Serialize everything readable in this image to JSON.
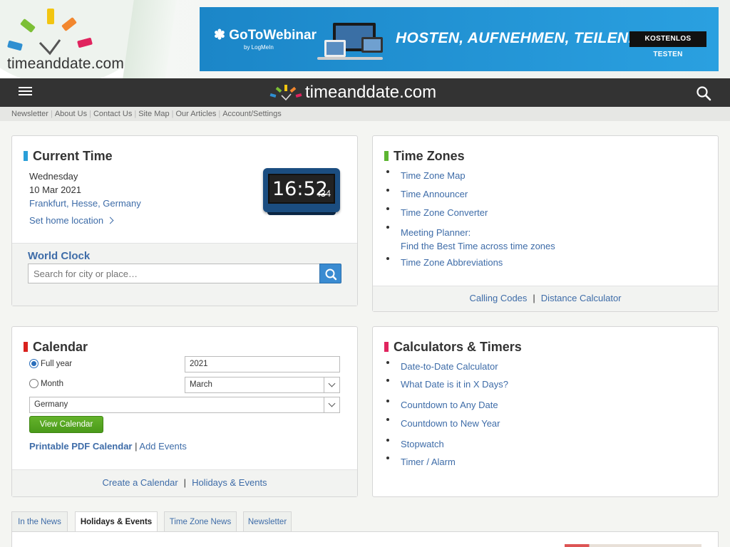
{
  "header": {
    "logo_text": "timeanddate.com",
    "ad": {
      "brand": "GoToWebinar",
      "brand_sub": "by LogMeIn",
      "headline": "HOSTEN, AUFNEHMEN, TEILEN.",
      "cta": "KOSTENLOS TESTEN"
    }
  },
  "navbar": {
    "brand": "timeanddate.com",
    "menu_icon": "hamburger-menu-icon",
    "search_icon": "search-icon"
  },
  "subnav": {
    "links": [
      "Newsletter",
      "About Us",
      "Contact Us",
      "Site Map",
      "Our Articles",
      "Account/Settings"
    ]
  },
  "current_time": {
    "title": "Current Time",
    "accent": "#2a9fd8",
    "day": "Wednesday",
    "date": "10 Mar 2021",
    "location": "Frankfurt, Hesse, Germany",
    "set_home": "Set home location",
    "clock": {
      "time": "16:52",
      "seconds": "34"
    },
    "world_clock": {
      "title": "World Clock",
      "placeholder": "Search for city or place…"
    }
  },
  "time_zones": {
    "title": "Time Zones",
    "accent": "#5cb531",
    "links": [
      "Time Zone Map",
      "Time Announcer",
      "Time Zone Converter",
      "Meeting Planner:",
      "Time Zone Abbreviations"
    ],
    "meeting_sub": "Find the Best Time across time zones",
    "footer": [
      "Calling Codes",
      "Distance Calculator"
    ]
  },
  "calendar": {
    "title": "Calendar",
    "accent": "#d9211d",
    "full_year_label": "Full year",
    "month_label": "Month",
    "year_value": "2021",
    "month_value": "March",
    "country_value": "Germany",
    "view_button": "View Calendar",
    "pdf_link": "Printable PDF Calendar",
    "separator": "|",
    "add_events": "Add Events",
    "footer": [
      "Create a Calendar",
      "Holidays & Events"
    ]
  },
  "calculators": {
    "title": "Calculators & Timers",
    "accent": "#e0245e",
    "links": [
      "Date-to-Date Calculator",
      "What Date is it in X Days?",
      "Countdown to Any Date",
      "Countdown to New Year",
      "Stopwatch",
      "Timer / Alarm"
    ]
  },
  "news_tabs": {
    "tabs": [
      "In the News",
      "Holidays & Events",
      "Time Zone News",
      "Newsletter"
    ],
    "active": "Holidays & Events"
  }
}
